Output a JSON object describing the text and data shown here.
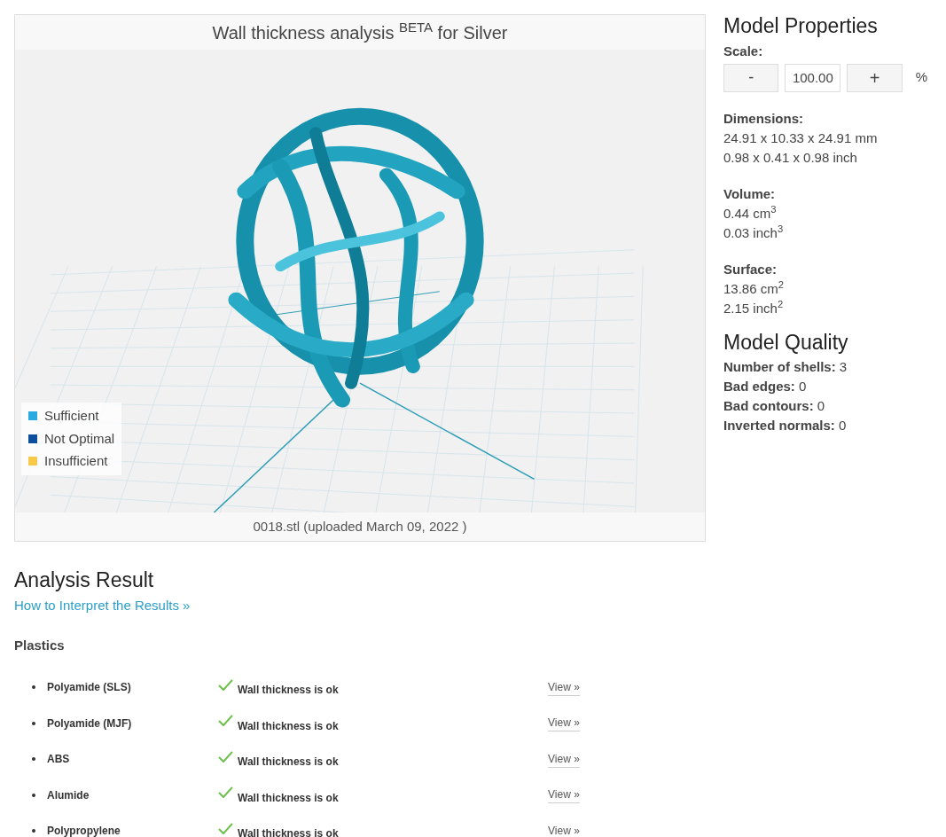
{
  "viewer": {
    "title": "Wall thickness analysis $^{BETA}$ for Silver",
    "legend": [
      {
        "label": "Sufficient",
        "color": "#29abe2"
      },
      {
        "label": "Not Optimal",
        "color": "#0d4f9c"
      },
      {
        "label": "Insufficient",
        "color": "#f6c94a"
      }
    ],
    "caption": "0018.stl (uploaded March 09, 2022 )"
  },
  "properties": {
    "title": "Model Properties",
    "scale": {
      "label": "Scale:",
      "minus": "-",
      "value": "100.00",
      "plus": "+",
      "unit": "%"
    },
    "groups": [
      {
        "label": "Dimensions:",
        "lines": [
          "24.91 x 10.33 x 24.91 mm",
          "0.98 x 0.41 x 0.98 inch"
        ]
      },
      {
        "label": "Volume:",
        "lines": [
          "0.44 cm$^{3}$",
          "0.03 inch$^{3}$"
        ]
      },
      {
        "label": "Surface:",
        "lines": [
          "13.86 cm$^{2}$",
          "2.15 inch$^{2}$"
        ]
      }
    ]
  },
  "quality": {
    "title": "Model Quality",
    "items": [
      {
        "label": "Number of shells:",
        "value": "3"
      },
      {
        "label": "Bad edges:",
        "value": "0"
      },
      {
        "label": "Bad contours:",
        "value": "0"
      },
      {
        "label": "Inverted normals:",
        "value": "0"
      }
    ]
  },
  "analysis": {
    "title": "Analysis Result",
    "link": "How to Interpret the Results »",
    "section": "Plastics",
    "rows": [
      {
        "material": "Polyamide (SLS)",
        "kind": "ok",
        "result": "Wall thickness is ok",
        "action": "View »"
      },
      {
        "material": "Polyamide (MJF)",
        "kind": "ok",
        "result": "Wall thickness is ok",
        "action": "View »"
      },
      {
        "material": "ABS",
        "kind": "ok",
        "result": "Wall thickness is ok",
        "action": "View »"
      },
      {
        "material": "Alumide",
        "kind": "ok",
        "result": "Wall thickness is ok",
        "action": "View »"
      },
      {
        "material": "Polypropylene",
        "kind": "ok",
        "result": "Wall thickness is ok",
        "action": "View »"
      }
    ]
  }
}
